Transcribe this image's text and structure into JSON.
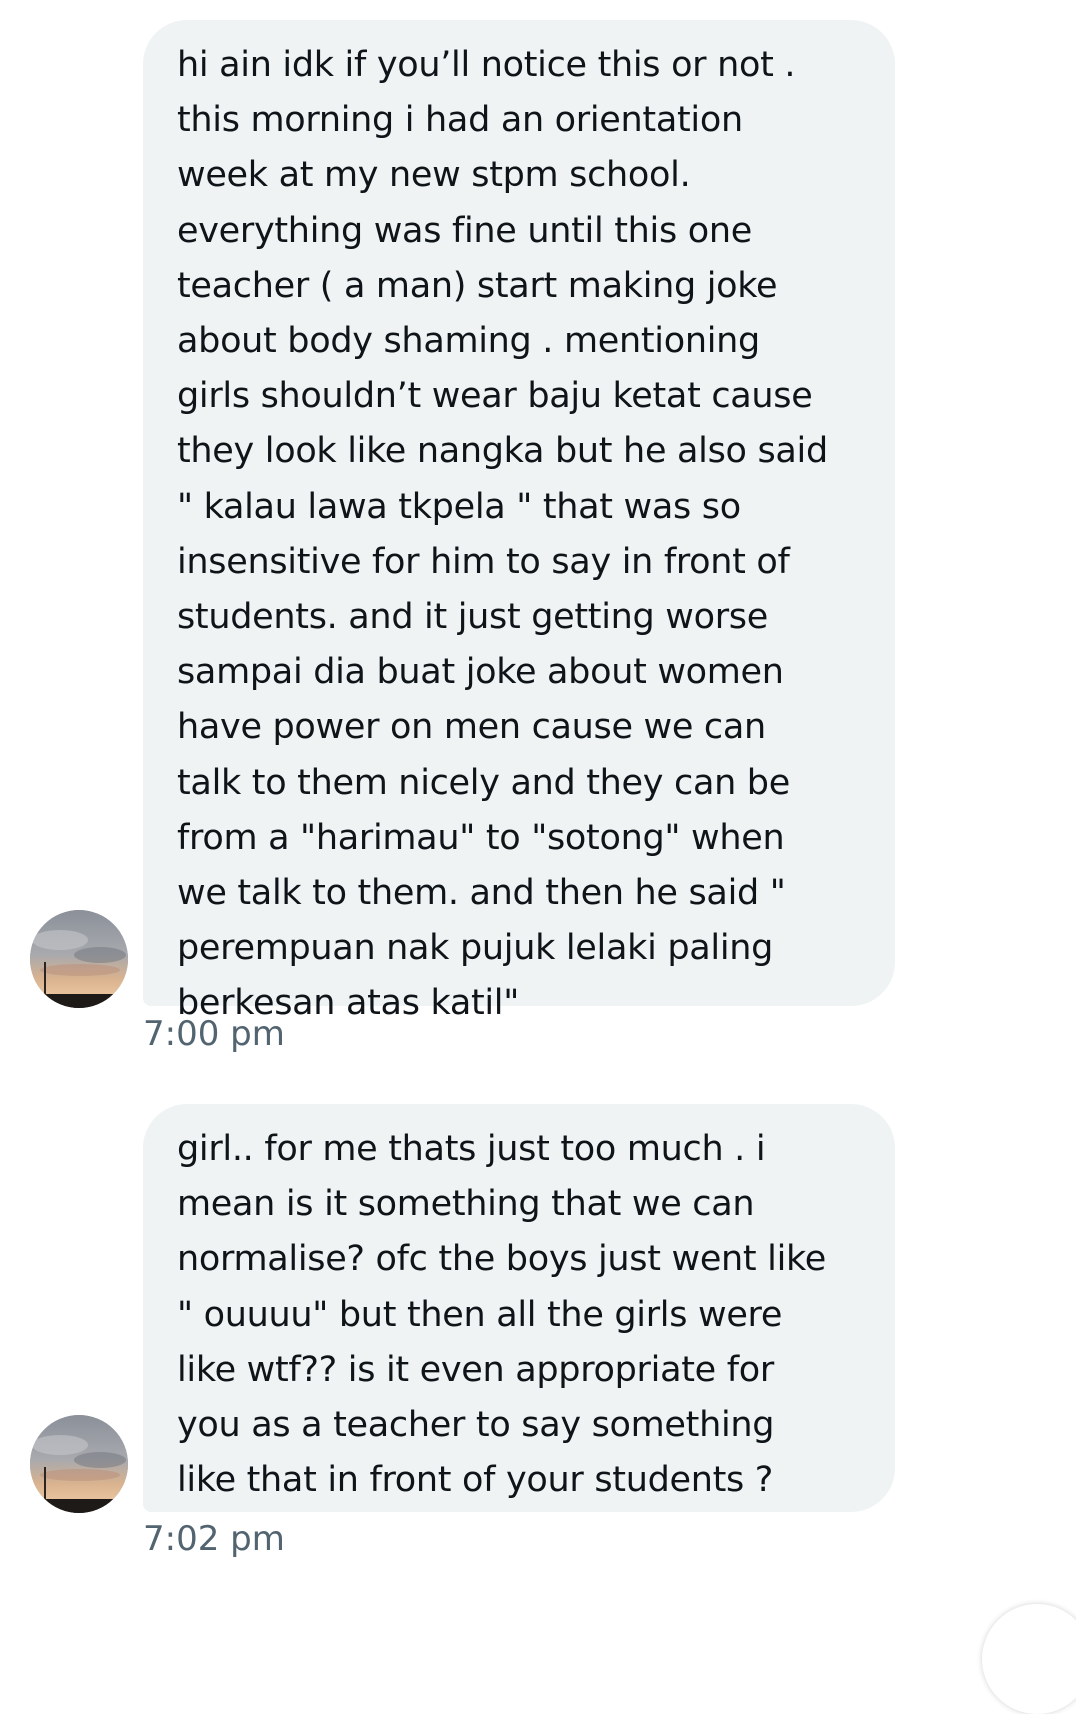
{
  "messages": [
    {
      "lines": [
        "hi ain idk if you’ll notice this or not .",
        "this morning i had an orientation",
        "week at my new stpm school.",
        "everything was fine until this one",
        "teacher ( a man) start making joke",
        "about body shaming . mentioning",
        "girls shouldn’t wear baju ketat cause",
        "they look like nangka but he also said",
        "\" kalau lawa tkpela \" that was so",
        "insensitive for him to say in front of",
        "students. and it just getting worse",
        "sampai dia buat joke about women",
        "have power on men cause we can",
        "talk to them nicely and they can be",
        "from a \"harimau\" to \"sotong\" when",
        "we talk to them. and then he said \"",
        "perempuan nak pujuk lelaki paling",
        "berkesan atas katil\""
      ],
      "time": "7:00 pm"
    },
    {
      "lines": [
        "girl.. for me thats just too much . i",
        "mean is it something that we can",
        "normalise? ofc the boys just went like",
        "\" ouuuu\" but then all the girls were",
        "like wtf?? is it even appropriate for",
        "you as a teacher to say something",
        "like that in front of your students ?"
      ],
      "time": "7:02 pm"
    }
  ],
  "colors": {
    "bubble_background": "#eff3f4",
    "message_text": "#0f1419",
    "timestamp_text": "#536471",
    "page_background": "#ffffff"
  },
  "icons": {
    "avatar": "sunset-sky-avatar",
    "scroll_button": "scroll-to-bottom-button"
  }
}
